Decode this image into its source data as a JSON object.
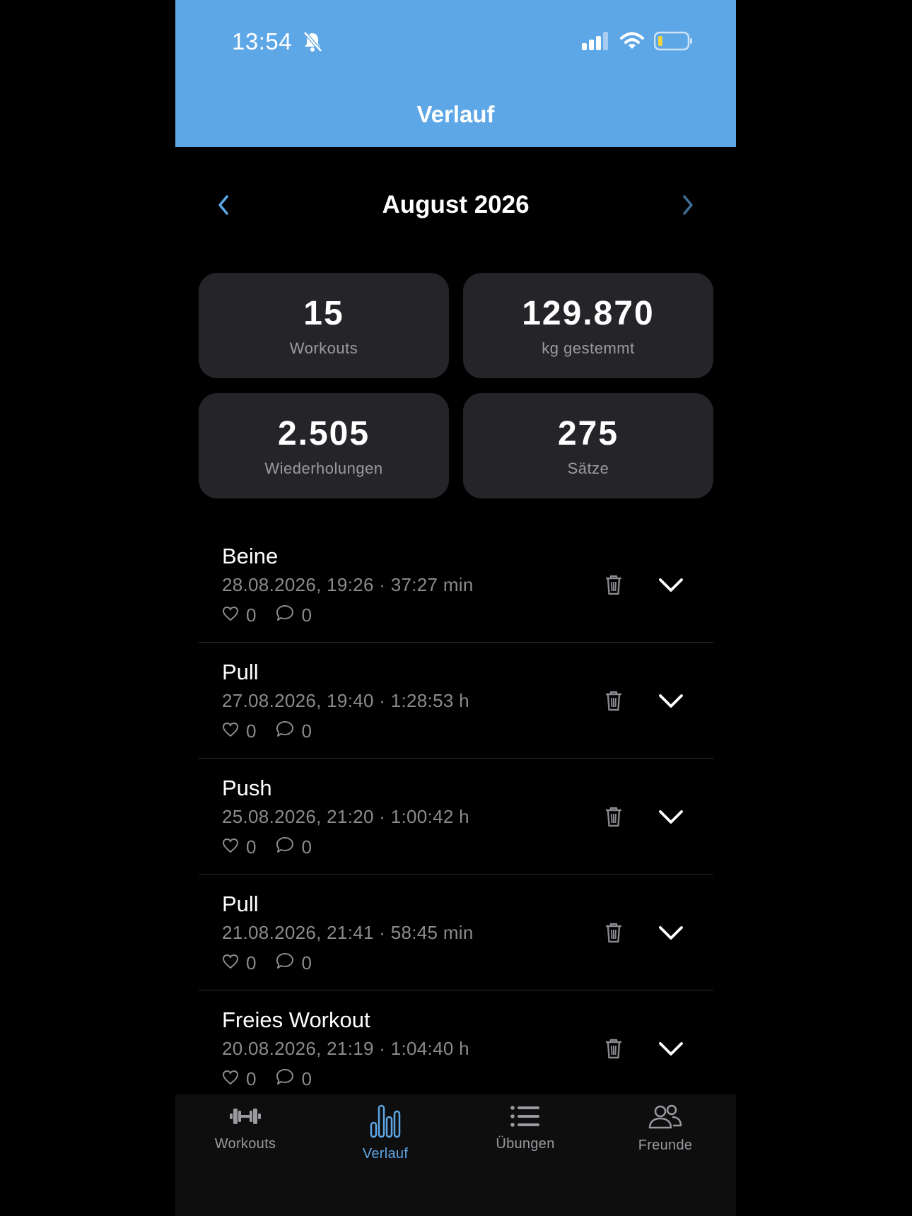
{
  "status_bar": {
    "time": "13:54"
  },
  "nav": {
    "title": "Verlauf"
  },
  "month_selector": {
    "label": "August 2026"
  },
  "stats": [
    {
      "value": "15",
      "label": "Workouts"
    },
    {
      "value": "129.870",
      "label": "kg gestemmt"
    },
    {
      "value": "2.505",
      "label": "Wiederholungen"
    },
    {
      "value": "275",
      "label": "Sätze"
    }
  ],
  "workouts": [
    {
      "title": "Beine",
      "meta": "28.08.2026, 19:26 · 37:27 min",
      "likes": "0",
      "comments": "0"
    },
    {
      "title": "Pull",
      "meta": "27.08.2026, 19:40 · 1:28:53 h",
      "likes": "0",
      "comments": "0"
    },
    {
      "title": "Push",
      "meta": "25.08.2026, 21:20 · 1:00:42 h",
      "likes": "0",
      "comments": "0"
    },
    {
      "title": "Pull",
      "meta": "21.08.2026, 21:41 · 58:45 min",
      "likes": "0",
      "comments": "0"
    },
    {
      "title": "Freies Workout",
      "meta": "20.08.2026, 21:19 · 1:04:40 h",
      "likes": "0",
      "comments": "0"
    }
  ],
  "tabbar": {
    "items": [
      {
        "label": "Workouts",
        "icon": "dumbbell-icon",
        "active": false
      },
      {
        "label": "Verlauf",
        "icon": "bar-chart-icon",
        "active": true
      },
      {
        "label": "Übungen",
        "icon": "list-icon",
        "active": false
      },
      {
        "label": "Freunde",
        "icon": "people-icon",
        "active": false
      }
    ]
  },
  "colors": {
    "accent": "#5ea7e6",
    "card": "#252529",
    "background": "#000000",
    "muted": "#8a8a8f"
  }
}
